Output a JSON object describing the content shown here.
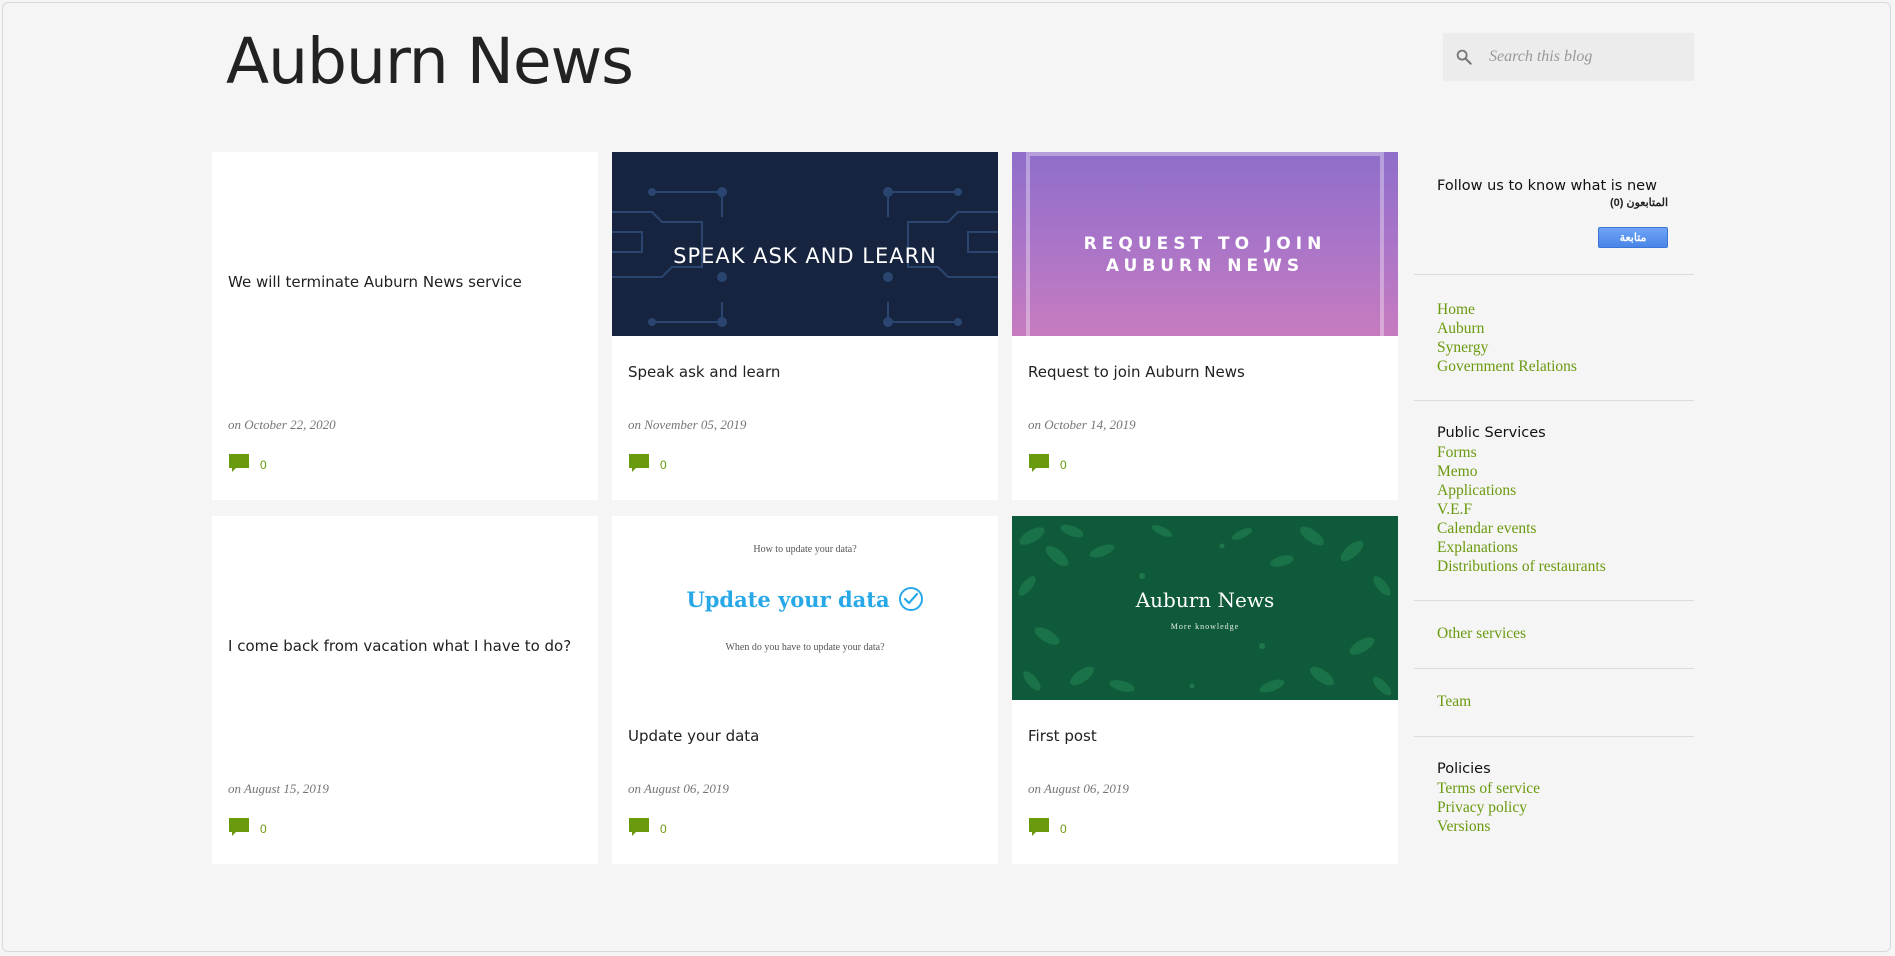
{
  "header": {
    "title": "Auburn News",
    "search_placeholder": "Search this blog"
  },
  "posts": [
    {
      "title": "We will terminate Auburn News service",
      "date": "on October 22, 2020",
      "comments": "0",
      "image": "none"
    },
    {
      "title": "Speak ask and learn",
      "date": "on November 05, 2019",
      "comments": "0",
      "image": "speak-ask-learn-banner",
      "image_text": "SPEAK ASK AND LEARN"
    },
    {
      "title": "Request to join Auburn News",
      "date": "on October 14, 2019",
      "comments": "0",
      "image": "request-to-join-banner",
      "image_text_1": "REQUEST TO JOIN",
      "image_text_2": "AUBURN NEWS"
    },
    {
      "title": "I come back from vacation what I have to do?",
      "date": "on August 15, 2019",
      "comments": "0",
      "image": "none"
    },
    {
      "title": "Update your data",
      "date": "on August 06, 2019",
      "comments": "0",
      "image": "update-data-banner",
      "image_text_top": "How to update your data?",
      "image_text_main": "Update your data",
      "image_text_bottom": "When do you have to update your data?"
    },
    {
      "title": "First post",
      "date": "on August 06, 2019",
      "comments": "0",
      "image": "first-post-banner",
      "image_text_main": "Auburn News",
      "image_text_sub": "More knowledge"
    }
  ],
  "sidebar": {
    "follow": {
      "title": "Follow us to know what is new",
      "followers": "المتابعون (0)",
      "button_label": "متابعة"
    },
    "pages": [
      "Home",
      "Auburn",
      "Synergy",
      "Government Relations"
    ],
    "public_services": {
      "heading": "Public Services",
      "links": [
        "Forms",
        "Memo",
        "Applications",
        "V.E.F",
        "Calendar events",
        "Explanations",
        "Distributions of restaurants"
      ]
    },
    "other_services": "Other services",
    "team": "Team",
    "policies": {
      "heading": "Policies",
      "links": [
        "Terms of service",
        "Privacy policy",
        "Versions"
      ]
    }
  },
  "colors": {
    "accent_green": "#6a9a0e",
    "background": "#f5f5f5",
    "card": "#ffffff",
    "follow_button": "#4a86e8"
  }
}
